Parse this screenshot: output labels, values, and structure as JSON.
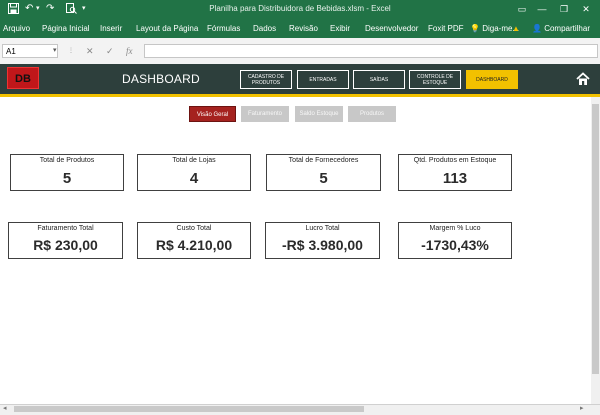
{
  "window": {
    "title": "Planilha para Distribuidora de Bebidas.xlsm - Excel"
  },
  "menu": {
    "items": [
      "Arquivo",
      "Página Inicial",
      "Inserir",
      "Layout da Página",
      "Fórmulas",
      "Dados",
      "Revisão",
      "Exibir",
      "Desenvolvedor",
      "Foxit PDF"
    ],
    "tell_me": "Diga-me...",
    "share": "Compartilhar"
  },
  "formula_bar": {
    "name_box": "A1",
    "fx": "fx",
    "value": ""
  },
  "dashboard": {
    "logo": "DB",
    "title": "DASHBOARD",
    "nav": [
      "CADASTRO DE PRODUTOS",
      "ENTRADAS",
      "SAÍDAS",
      "CONTROLE DE ESTOQUE",
      "DASHBOARD"
    ],
    "tabs": [
      "Visão Geral",
      "Faturamento",
      "Saldo Estoque",
      "Produtos"
    ],
    "cards": [
      {
        "label": "Total de Produtos",
        "value": "5"
      },
      {
        "label": "Total de Lojas",
        "value": "4"
      },
      {
        "label": "Total de Fornecedores",
        "value": "5"
      },
      {
        "label": "Qtd. Produtos em Estoque",
        "value": "113"
      },
      {
        "label": "Faturamento Total",
        "value": "R$ 230,00"
      },
      {
        "label": "Custo Total",
        "value": "R$ 4.210,00"
      },
      {
        "label": "Lucro Total",
        "value": "-R$ 3.980,00"
      },
      {
        "label": "Margem % Luco",
        "value": "-1730,43%"
      }
    ]
  },
  "colors": {
    "excel_green": "#217346",
    "header_dark": "#2d3f3c",
    "accent_yellow": "#f2c100",
    "active_tab": "#a5221f",
    "inactive_tab": "#c8c8c8"
  }
}
